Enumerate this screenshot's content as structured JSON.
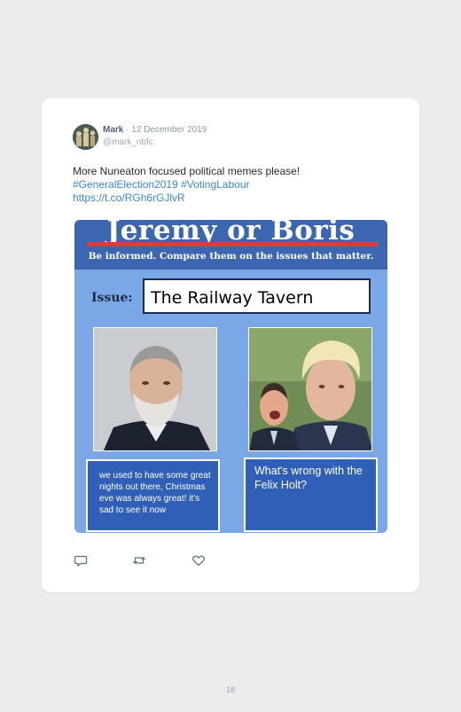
{
  "tweet": {
    "author_name": "Mark",
    "separator": "·",
    "date": "12 December 2019",
    "handle": "@mark_nbfc",
    "text": "More Nuneaton focused political memes please!",
    "hashtags": "#GeneralElection2019 #VotingLabour",
    "url": "https://t.co/RGh6rGJlvR"
  },
  "meme": {
    "title": "Jeremy or Boris",
    "subtitle": "Be informed. Compare them on the issues that matter.",
    "issue_label": "Issue:",
    "issue_value": "The Railway Tavern",
    "left_caption": "we used to have some great nights out there, Christmas eve was always great! it's sad to see it now",
    "right_caption": "What's wrong with the Felix Holt?"
  },
  "actions": {
    "reply_icon": "reply-icon",
    "retweet_icon": "retweet-icon",
    "like_icon": "heart-icon"
  },
  "page": {
    "number": "18"
  },
  "colors": {
    "background": "#ececee",
    "card": "#ffffff",
    "link": "#3a86d8",
    "meme_blue": "#7aa8e6",
    "meme_header": "#3c67b0",
    "caption_blue": "#2f5fb7",
    "title_rule": "#e03a3a"
  }
}
